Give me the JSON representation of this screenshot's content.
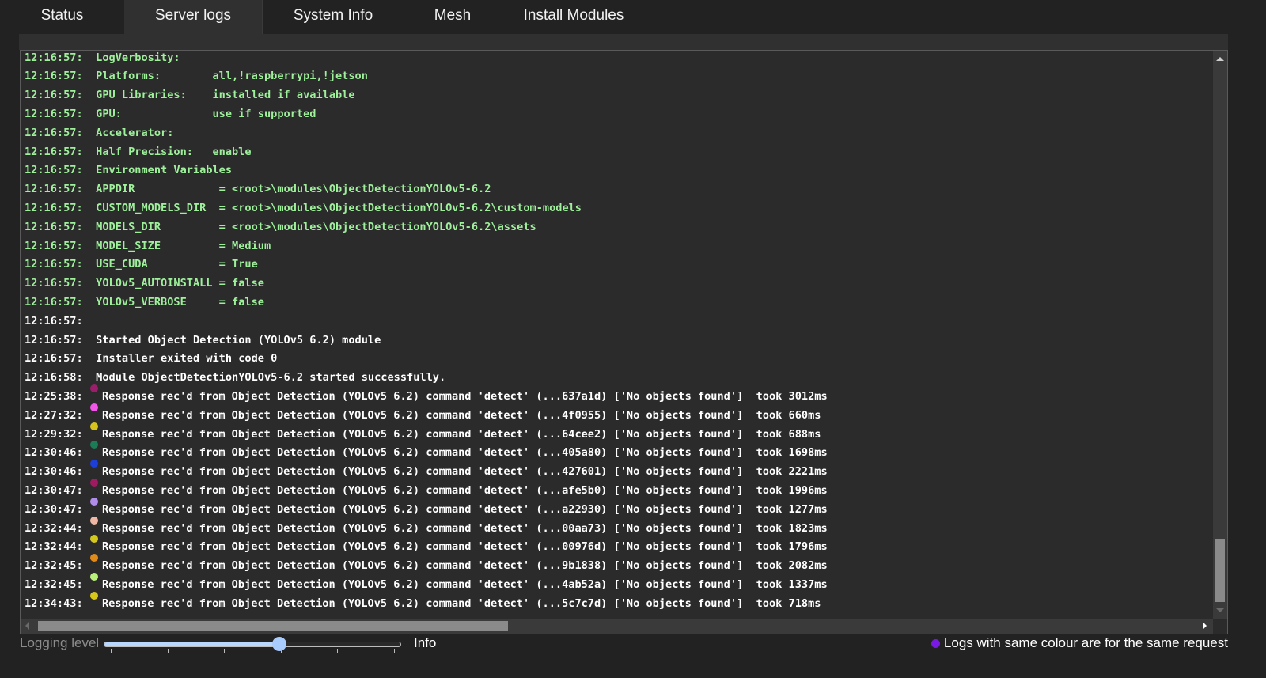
{
  "tabs": [
    {
      "label": "Status",
      "active": false
    },
    {
      "label": "Server logs",
      "active": true
    },
    {
      "label": "System Info",
      "active": false
    },
    {
      "label": "Mesh",
      "active": false
    },
    {
      "label": "Install Modules",
      "active": false
    }
  ],
  "log": [
    {
      "time": "12:16:57:",
      "text": " LogVerbosity:",
      "color": "green"
    },
    {
      "time": "12:16:57:",
      "text": " Platforms:        all,!raspberrypi,!jetson",
      "color": "green"
    },
    {
      "time": "12:16:57:",
      "text": " GPU Libraries:    installed if available",
      "color": "green"
    },
    {
      "time": "12:16:57:",
      "text": " GPU:              use if supported",
      "color": "green"
    },
    {
      "time": "12:16:57:",
      "text": " Accelerator:",
      "color": "green"
    },
    {
      "time": "12:16:57:",
      "text": " Half Precision:   enable",
      "color": "green"
    },
    {
      "time": "12:16:57:",
      "text": " Environment Variables",
      "color": "green"
    },
    {
      "time": "12:16:57:",
      "text": " APPDIR             = <root>\\modules\\ObjectDetectionYOLOv5-6.2",
      "color": "green"
    },
    {
      "time": "12:16:57:",
      "text": " CUSTOM_MODELS_DIR  = <root>\\modules\\ObjectDetectionYOLOv5-6.2\\custom-models",
      "color": "green"
    },
    {
      "time": "12:16:57:",
      "text": " MODELS_DIR         = <root>\\modules\\ObjectDetectionYOLOv5-6.2\\assets",
      "color": "green"
    },
    {
      "time": "12:16:57:",
      "text": " MODEL_SIZE         = Medium",
      "color": "green"
    },
    {
      "time": "12:16:57:",
      "text": " USE_CUDA           = True",
      "color": "green"
    },
    {
      "time": "12:16:57:",
      "text": " YOLOv5_AUTOINSTALL = false",
      "color": "green"
    },
    {
      "time": "12:16:57:",
      "text": " YOLOv5_VERBOSE     = false",
      "color": "green"
    },
    {
      "time": "12:16:57:",
      "text": "",
      "color": "white"
    },
    {
      "time": "12:16:57:",
      "text": " Started Object Detection (YOLOv5 6.2) module",
      "color": "white"
    },
    {
      "time": "12:16:57:",
      "text": " Installer exited with code 0",
      "color": "white"
    },
    {
      "time": "12:16:58:",
      "text": " Module ObjectDetectionYOLOv5-6.2 started successfully.",
      "color": "white"
    },
    {
      "time": "12:25:38:",
      "dot": "#9c1e6a",
      "text": "Response rec'd from Object Detection (YOLOv5 6.2) command 'detect' (...637a1d) ['No objects found']  took 3012ms",
      "color": "white"
    },
    {
      "time": "12:27:32:",
      "dot": "#f057e6",
      "text": "Response rec'd from Object Detection (YOLOv5 6.2) command 'detect' (...4f0955) ['No objects found']  took 660ms",
      "color": "white"
    },
    {
      "time": "12:29:32:",
      "dot": "#d6c21a",
      "text": "Response rec'd from Object Detection (YOLOv5 6.2) command 'detect' (...64cee2) ['No objects found']  took 688ms",
      "color": "white"
    },
    {
      "time": "12:30:46:",
      "dot": "#1b7d55",
      "text": "Response rec'd from Object Detection (YOLOv5 6.2) command 'detect' (...405a80) ['No objects found']  took 1698ms",
      "color": "white"
    },
    {
      "time": "12:30:46:",
      "dot": "#1e3fd6",
      "text": "Response rec'd from Object Detection (YOLOv5 6.2) command 'detect' (...427601) ['No objects found']  took 2221ms",
      "color": "white"
    },
    {
      "time": "12:30:47:",
      "dot": "#a01a62",
      "text": "Response rec'd from Object Detection (YOLOv5 6.2) command 'detect' (...afe5b0) ['No objects found']  took 1996ms",
      "color": "white"
    },
    {
      "time": "12:30:47:",
      "dot": "#b08ee8",
      "text": "Response rec'd from Object Detection (YOLOv5 6.2) command 'detect' (...a22930) ['No objects found']  took 1277ms",
      "color": "white"
    },
    {
      "time": "12:32:44:",
      "dot": "#f0b8a4",
      "text": "Response rec'd from Object Detection (YOLOv5 6.2) command 'detect' (...00aa73) ['No objects found']  took 1823ms",
      "color": "white"
    },
    {
      "time": "12:32:44:",
      "dot": "#d4c81c",
      "text": "Response rec'd from Object Detection (YOLOv5 6.2) command 'detect' (...00976d) ['No objects found']  took 1796ms",
      "color": "white"
    },
    {
      "time": "12:32:45:",
      "dot": "#e08a1a",
      "text": "Response rec'd from Object Detection (YOLOv5 6.2) command 'detect' (...9b1838) ['No objects found']  took 2082ms",
      "color": "white"
    },
    {
      "time": "12:32:45:",
      "dot": "#b8f07a",
      "text": "Response rec'd from Object Detection (YOLOv5 6.2) command 'detect' (...4ab52a) ['No objects found']  took 1337ms",
      "color": "white"
    },
    {
      "time": "12:34:43:",
      "dot": "#d6c81a",
      "text": "Response rec'd from Object Detection (YOLOv5 6.2) command 'detect' (...5c7c7d) ['No objects found']  took 718ms",
      "color": "white"
    }
  ],
  "footer": {
    "logging_label": "Logging level",
    "level_value": "Info",
    "slider_fraction": 0.59,
    "slider_ticks": 6,
    "legend_text": "Logs with same colour are for the same request",
    "legend_dot_color": "#7a18e8"
  },
  "colors": {
    "green_text": "#9ef09b",
    "white_text": "#ffffff",
    "background": "#222222"
  }
}
